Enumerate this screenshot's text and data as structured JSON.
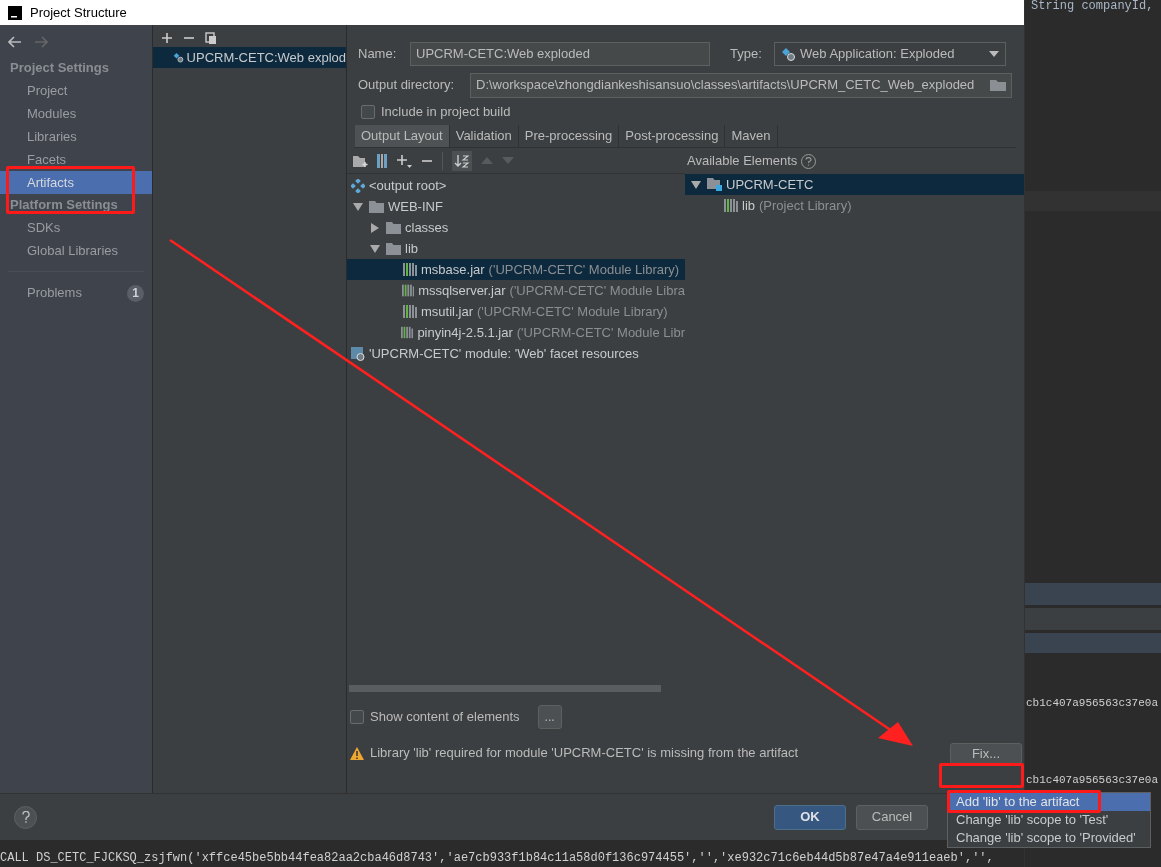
{
  "window": {
    "title": "Project Structure"
  },
  "sidebar": {
    "sections": [
      {
        "heading": "Project Settings",
        "items": [
          {
            "label": "Project",
            "selected": false,
            "annotated": false
          },
          {
            "label": "Modules",
            "selected": false,
            "annotated": false
          },
          {
            "label": "Libraries",
            "selected": false,
            "annotated": false
          },
          {
            "label": "Facets",
            "selected": false,
            "annotated": false
          },
          {
            "label": "Artifacts",
            "selected": true,
            "annotated": true
          }
        ]
      },
      {
        "heading": "Platform Settings",
        "items": [
          {
            "label": "SDKs",
            "selected": false,
            "annotated": false
          },
          {
            "label": "Global Libraries",
            "selected": false,
            "annotated": false
          }
        ]
      }
    ],
    "problems": {
      "label": "Problems",
      "count": "1"
    }
  },
  "artifacts_list": {
    "items": [
      {
        "label": "UPCRM-CETC:Web explod",
        "selected": true
      }
    ]
  },
  "name_field": {
    "label": "Name:",
    "value": "UPCRM-CETC:Web exploded"
  },
  "type_field": {
    "label": "Type:",
    "value": "Web Application: Exploded"
  },
  "output_directory": {
    "label": "Output directory:",
    "value": "D:\\workspace\\zhongdiankeshisansuo\\classes\\artifacts\\UPCRM_CETC_Web_exploded"
  },
  "include_in_build": {
    "label": "Include in project build",
    "checked": false
  },
  "tabs": [
    {
      "label": "Output Layout",
      "selected": true
    },
    {
      "label": "Validation",
      "selected": false
    },
    {
      "label": "Pre-processing",
      "selected": false
    },
    {
      "label": "Post-processing",
      "selected": false
    },
    {
      "label": "Maven",
      "selected": false
    }
  ],
  "output_tree": [
    {
      "label": "<output root>",
      "kind": "root",
      "selected": false
    },
    {
      "label": "WEB-INF",
      "kind": "folder",
      "expanded": true,
      "selected": false,
      "children": [
        {
          "label": "classes",
          "kind": "folder",
          "expanded": false,
          "selected": false
        },
        {
          "label": "lib",
          "kind": "folder",
          "expanded": true,
          "selected": false,
          "children": [
            {
              "label": "msbase.jar",
              "detail": "('UPCRM-CETC' Module Library)",
              "kind": "library",
              "selected": true
            },
            {
              "label": "mssqlserver.jar",
              "detail": "('UPCRM-CETC' Module Libra",
              "kind": "library",
              "selected": false
            },
            {
              "label": "msutil.jar",
              "detail": "('UPCRM-CETC' Module Library)",
              "kind": "library",
              "selected": false
            },
            {
              "label": "pinyin4j-2.5.1.jar",
              "detail": "('UPCRM-CETC' Module Libr",
              "kind": "library",
              "selected": false
            }
          ]
        }
      ]
    },
    {
      "label": "'UPCRM-CETC' module: 'Web' facet resources",
      "kind": "facet",
      "selected": false
    }
  ],
  "available_elements": {
    "title": "Available Elements",
    "tree": [
      {
        "label": "UPCRM-CETC",
        "kind": "module",
        "expanded": true,
        "selected": true,
        "children": [
          {
            "label": "lib",
            "detail": "(Project Library)",
            "kind": "library",
            "selected": false
          }
        ]
      }
    ]
  },
  "show_content": {
    "label": "Show content of elements",
    "checked": false,
    "button": "..."
  },
  "warning": {
    "text": "Library 'lib' required for module 'UPCRM-CETC' is missing from the artifact",
    "fix_button": "Fix...",
    "fix_annotated": true
  },
  "fix_menu": [
    {
      "label": "Add 'lib' to the artifact",
      "selected": true,
      "annotated": true
    },
    {
      "label": "Change 'lib' scope to 'Test'",
      "selected": false,
      "annotated": false
    },
    {
      "label": "Change 'lib' scope to 'Provided'",
      "selected": false,
      "annotated": false
    }
  ],
  "buttons": [
    {
      "label": "OK",
      "primary": true
    },
    {
      "label": "Cancel",
      "primary": false
    }
  ],
  "arrow_annotation": true,
  "background_editor": {
    "top_line": "String companyId,",
    "right_lines": [
      "cb1c407a956563c37e0a",
      "cb1c407a956563c37e0a"
    ],
    "bottom_line": "CALL DS_CETC_FJCKSQ_zsjfwn('xffce45be5bb44fea82aa2cba46d8743','ae7cb933f1b84c11a58d0f136c974455','','xe932c71c6eb44d5b87e47a4e911eaeb','',"
  }
}
